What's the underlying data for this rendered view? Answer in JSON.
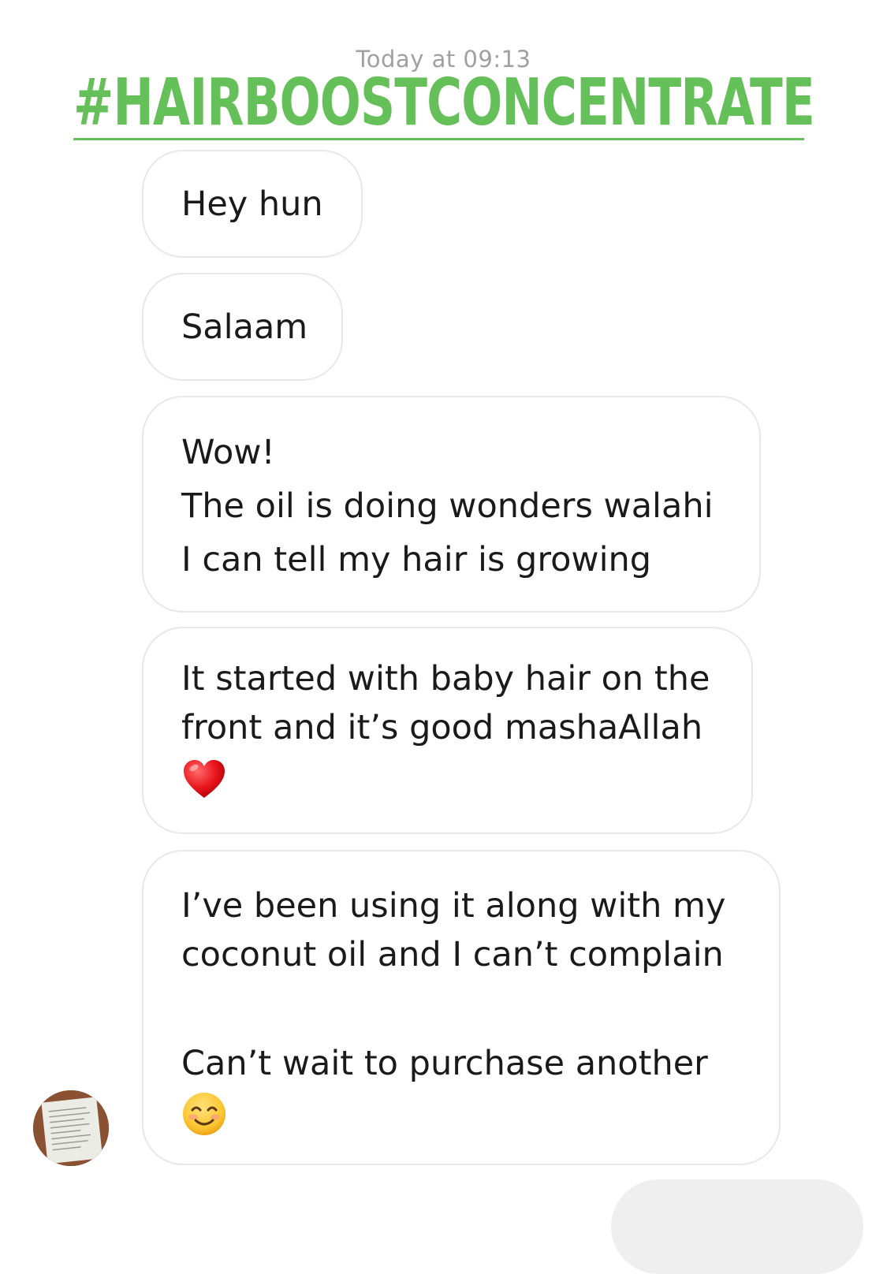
{
  "thread": {
    "timestamp": "Today at 09:13"
  },
  "overlay": {
    "hashtag": "#HAIRBOOSTCONCENTRATE",
    "hashtag_color": "#66c05a"
  },
  "messages": [
    {
      "lines": [
        "Hey hun"
      ]
    },
    {
      "lines": [
        "Salaam"
      ]
    },
    {
      "lines": [
        "Wow!",
        "The oil is doing wonders walahi",
        "I can tell my hair is growing"
      ]
    },
    {
      "lines": [
        "It started with baby hair on the",
        "front and it’s good mashaAllah"
      ],
      "emoji": "red-heart-icon"
    },
    {
      "lines": [
        "I’ve been using it along with my",
        "coconut oil and I can’t complain",
        "",
        "Can’t wait to purchase another"
      ],
      "emoji": "smiling-face-icon"
    }
  ],
  "colors": {
    "bubble_border": "#e8e8e8",
    "timestamp_text": "#a0a0a0",
    "outgoing_bubble": "#efefef"
  }
}
